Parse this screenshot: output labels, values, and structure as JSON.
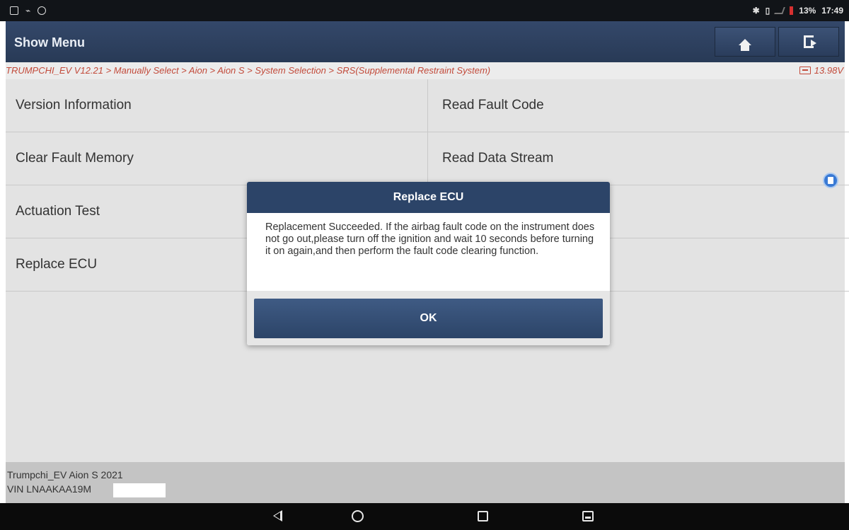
{
  "status_bar": {
    "battery_percent": "13%",
    "time": "17:49",
    "icons": [
      "image-icon",
      "usb-icon",
      "settings-icon",
      "bluetooth-icon",
      "vibrate-icon",
      "signal-icon",
      "battery-icon"
    ]
  },
  "header": {
    "title": "Show Menu",
    "home_icon": "home-icon",
    "exit_icon": "exit-icon"
  },
  "breadcrumb": {
    "path": "TRUMPCHI_EV V12.21 > Manually Select > Aion > Aion S > System Selection > SRS(Supplemental Restraint System)",
    "voltage": "13.98V"
  },
  "menu": {
    "items": [
      {
        "label": "Version Information"
      },
      {
        "label": "Read Fault Code"
      },
      {
        "label": "Clear Fault Memory"
      },
      {
        "label": "Read Data Stream"
      },
      {
        "label": "Actuation Test"
      },
      {
        "label": "Replace ECU"
      }
    ]
  },
  "dialog": {
    "title": "Replace ECU",
    "message": "Replacement Succeeded. If the airbag fault code on the instrument does not go out,please turn off the ignition and wait 10 seconds before turning it on again,and then perform the fault code clearing function.",
    "ok_label": "OK"
  },
  "footer": {
    "vehicle": "Trumpchi_EV Aion S 2021",
    "vin": "VIN LNAAKAA19M"
  },
  "colors": {
    "header": "#2c3e5a",
    "breadcrumb_text": "#c24a3a",
    "dialog_title": "#2c4468"
  }
}
